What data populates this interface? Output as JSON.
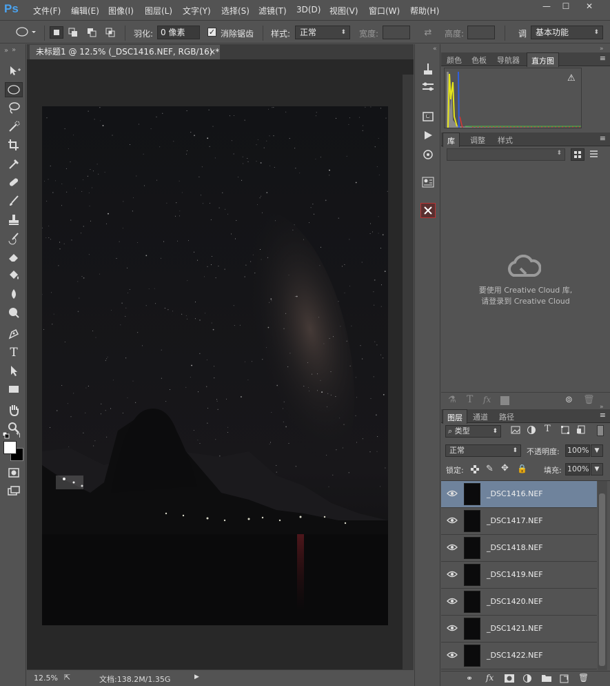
{
  "app": {
    "logo": "Ps"
  },
  "menu": [
    "文件(F)",
    "编辑(E)",
    "图像(I)",
    "图层(L)",
    "文字(Y)",
    "选择(S)",
    "滤镜(T)",
    "3D(D)",
    "视图(V)",
    "窗口(W)",
    "帮助(H)"
  ],
  "window_controls": {
    "minimize": "—",
    "maximize": "☐",
    "close": "✕"
  },
  "options": {
    "feather_label": "羽化:",
    "feather_value": "0 像素",
    "antialias_label": "消除锯齿",
    "style_label": "样式:",
    "style_value": "正常",
    "width_label": "宽度:",
    "height_label": "高度:",
    "adjust_label": "调",
    "workspace_value": "基本功能"
  },
  "document": {
    "tab_title": "未标题1 @ 12.5% (_DSC1416.NEF, RGB/16) *",
    "tab_close": "×",
    "zoom": "12.5%",
    "doc_info": "文档:138.2M/1.35G"
  },
  "panels": {
    "top_tabs": [
      "颜色",
      "色板",
      "导航器",
      "直方图"
    ],
    "top_active": "直方图",
    "histogram_warning": "⚠",
    "lib_tabs": [
      "库",
      "调整",
      "样式"
    ],
    "lib_active": "库",
    "cc_message_line1": "要使用 Creative Cloud 库,",
    "cc_message_line2": "请登录到 Creative Cloud",
    "layer_tabs": [
      "图层",
      "通道",
      "路径"
    ],
    "layer_active": "图层",
    "filter_label": "类型",
    "blend_mode": "正常",
    "opacity_label": "不透明度:",
    "opacity_value": "100%",
    "lock_label": "锁定:",
    "fill_label": "填充:",
    "fill_value": "100%",
    "layers": [
      {
        "name": "_DSC1416.NEF",
        "selected": true
      },
      {
        "name": "_DSC1417.NEF",
        "selected": false
      },
      {
        "name": "_DSC1418.NEF",
        "selected": false
      },
      {
        "name": "_DSC1419.NEF",
        "selected": false
      },
      {
        "name": "_DSC1420.NEF",
        "selected": false
      },
      {
        "name": "_DSC1421.NEF",
        "selected": false
      },
      {
        "name": "_DSC1422.NEF",
        "selected": false
      }
    ]
  },
  "colors": {
    "ui_bg": "#535353",
    "canvas_bg": "#282828",
    "layer_selected": "#6f839c",
    "ps_blue": "#4aa3f0"
  }
}
